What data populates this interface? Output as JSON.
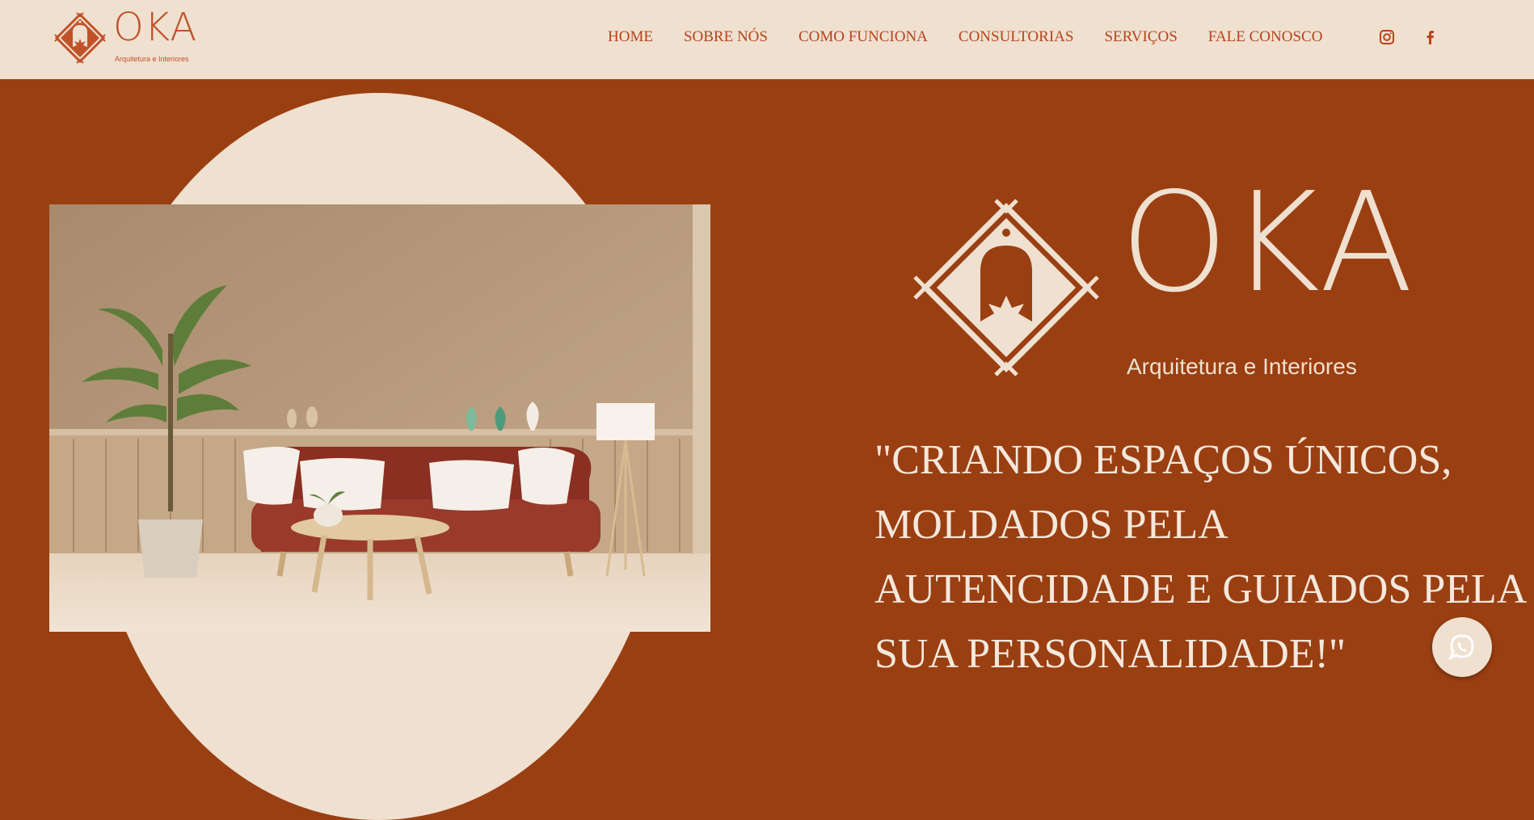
{
  "brand": {
    "name": "OKA",
    "tagline": "Arquitetura e Interiores",
    "color_primary": "#9a3f12",
    "color_cream": "#efe0d0",
    "color_nav": "#b6441b"
  },
  "nav": {
    "items": [
      {
        "label": "HOME"
      },
      {
        "label": "SOBRE NÓS"
      },
      {
        "label": "COMO FUNCIONA"
      },
      {
        "label": "CONSULTORIAS"
      },
      {
        "label": "SERVIÇOS"
      },
      {
        "label": "FALE CONOSCO"
      }
    ],
    "social_icons": [
      "instagram-icon",
      "facebook-icon"
    ]
  },
  "hero": {
    "quote": "\"CRIANDO ESPAÇOS ÚNICOS, MOLDADOS PELA AUTENCIDADE E GUIADOS PELA SUA PERSONALIDADE!\"",
    "image_icon": "living-room-photo"
  },
  "floating": {
    "icon": "whatsapp-icon"
  }
}
